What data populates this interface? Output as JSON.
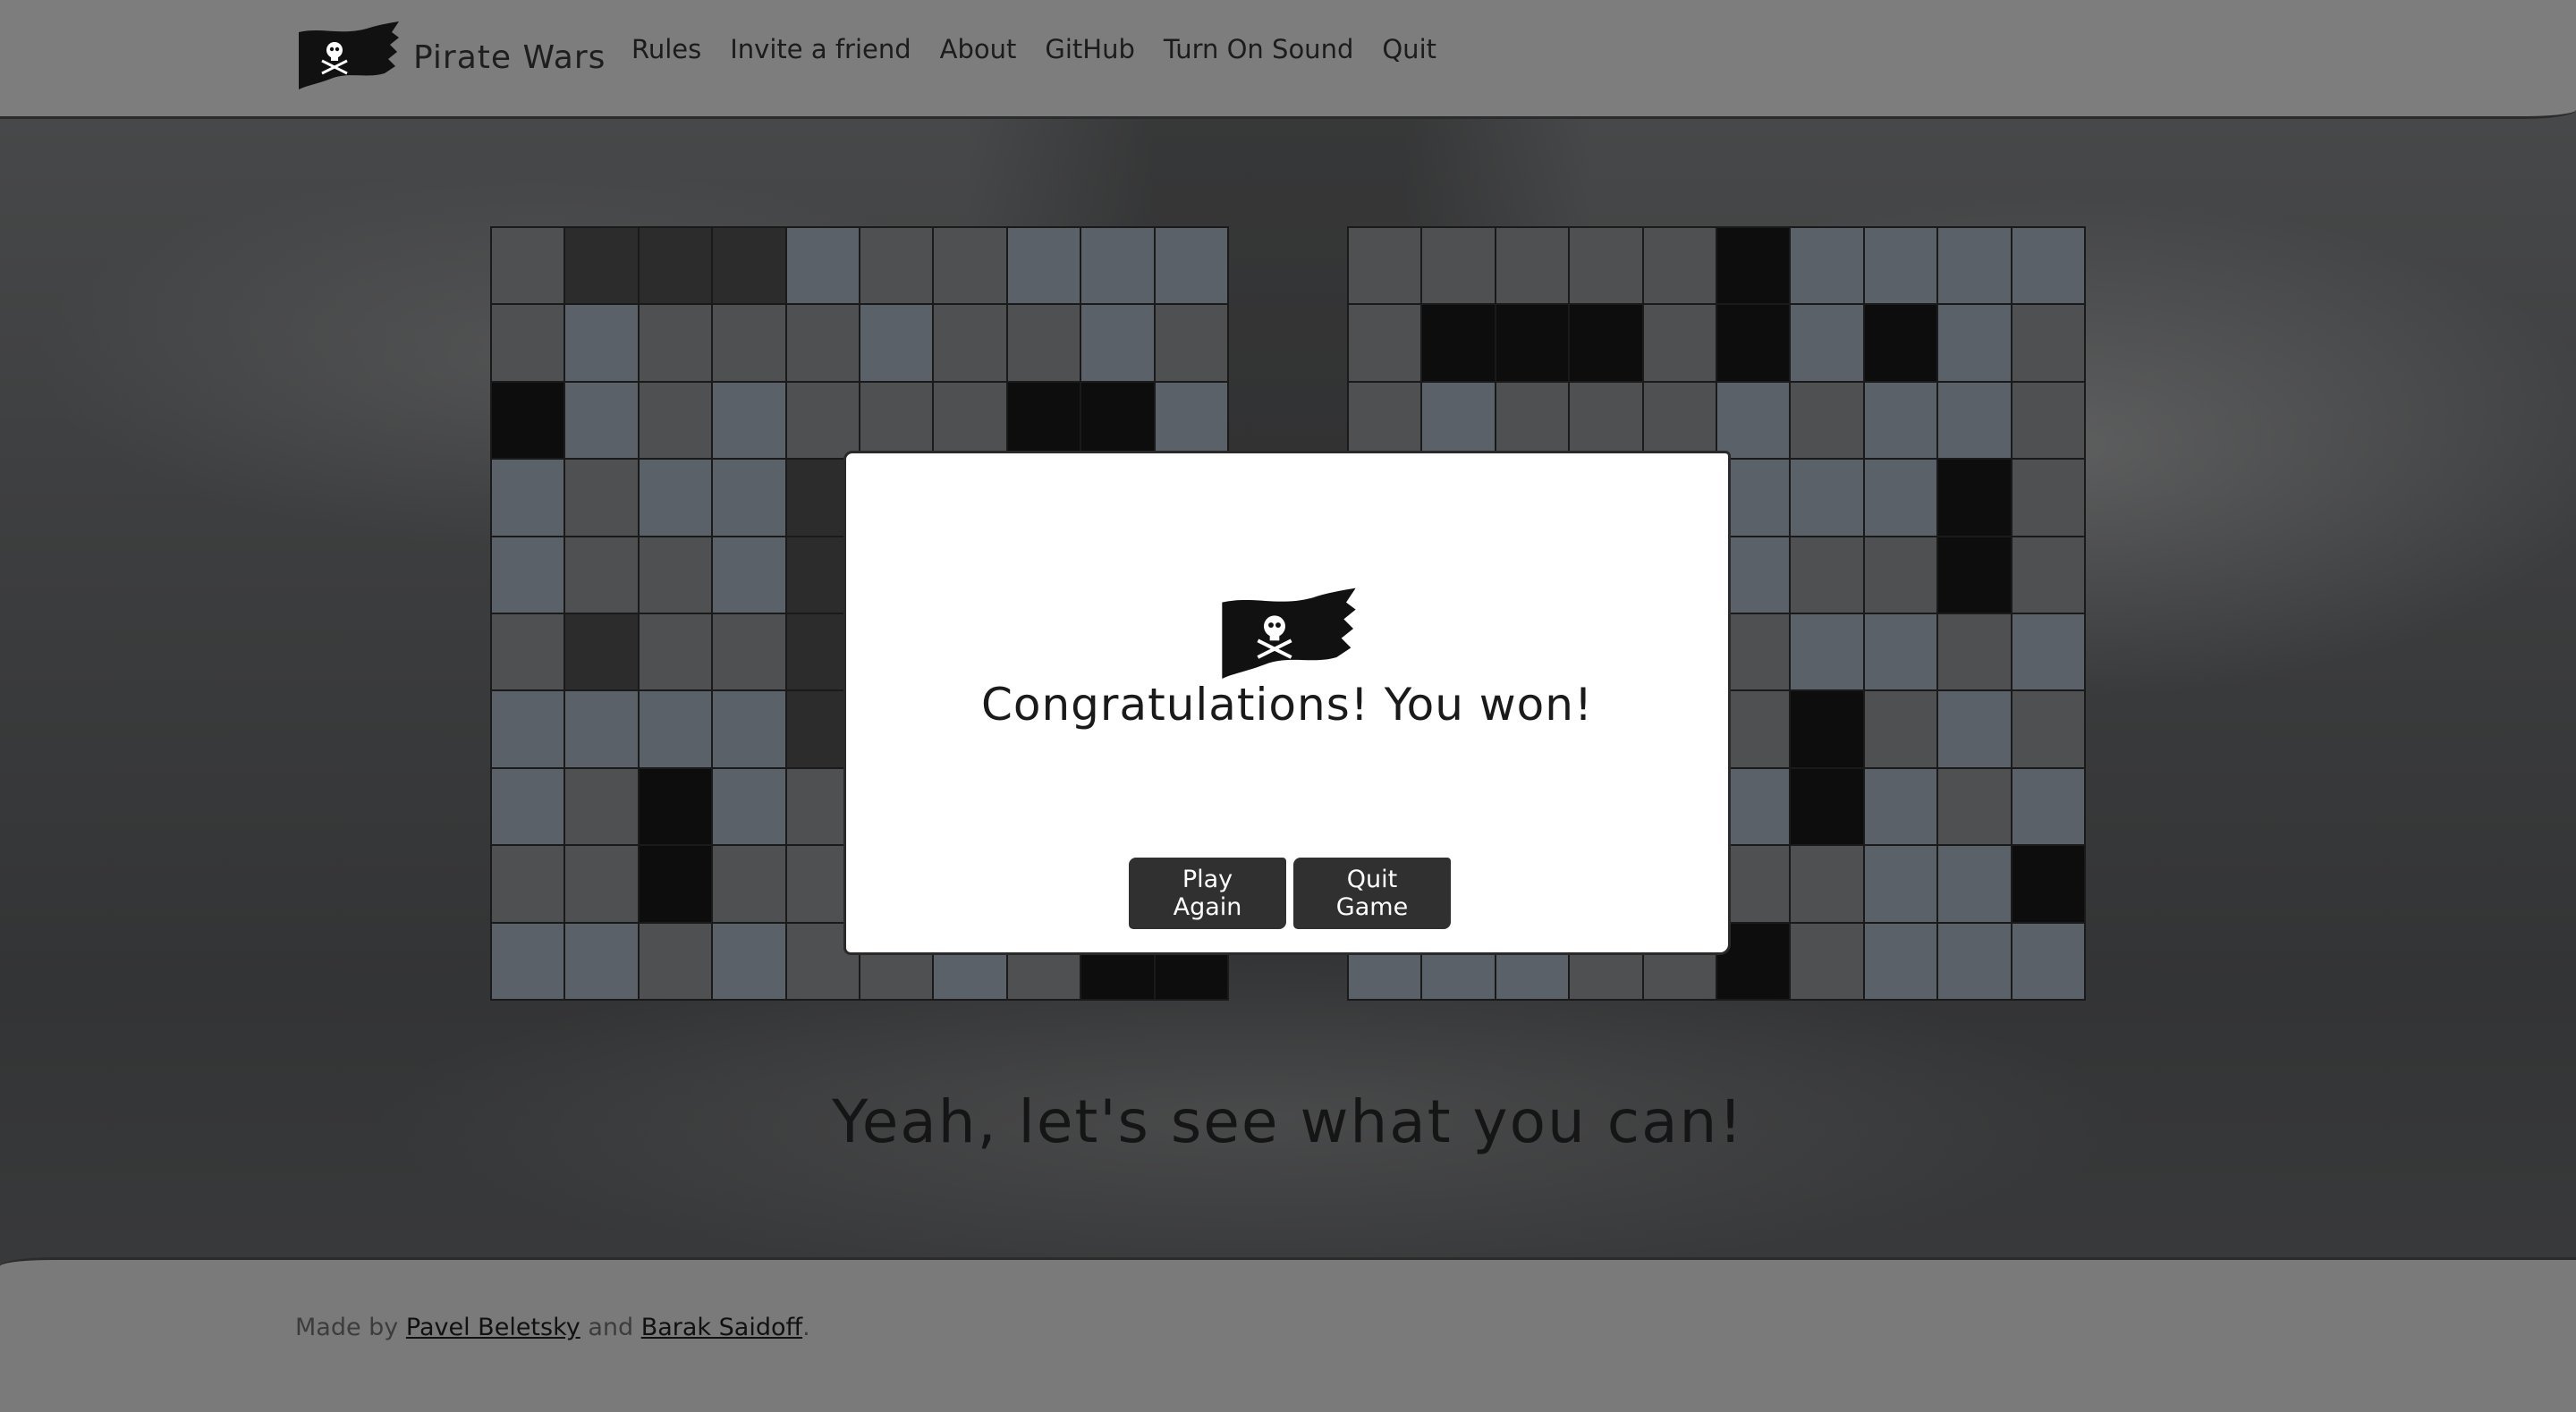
{
  "header": {
    "brand": "Pirate Wars",
    "logo_icon": "pirate-flag-icon",
    "nav": [
      "Rules",
      "Invite a friend",
      "About",
      "GitHub",
      "Turn On Sound",
      "Quit"
    ]
  },
  "boards": {
    "left": [
      [
        0,
        2,
        2,
        2,
        1,
        0,
        0,
        1,
        1,
        1
      ],
      [
        0,
        1,
        0,
        0,
        0,
        1,
        0,
        0,
        1,
        0
      ],
      [
        3,
        1,
        0,
        1,
        0,
        0,
        0,
        3,
        3,
        1
      ],
      [
        1,
        0,
        1,
        1,
        2,
        0,
        0,
        0,
        0,
        0
      ],
      [
        1,
        0,
        0,
        1,
        2,
        0,
        0,
        0,
        0,
        0
      ],
      [
        0,
        2,
        0,
        0,
        2,
        0,
        0,
        0,
        0,
        0
      ],
      [
        1,
        1,
        1,
        1,
        2,
        0,
        0,
        0,
        0,
        0
      ],
      [
        1,
        0,
        3,
        1,
        0,
        0,
        0,
        0,
        0,
        0
      ],
      [
        0,
        0,
        3,
        0,
        0,
        0,
        0,
        0,
        0,
        0
      ],
      [
        1,
        1,
        0,
        1,
        0,
        0,
        1,
        0,
        3,
        3
      ]
    ],
    "right": [
      [
        0,
        0,
        0,
        0,
        0,
        3,
        1,
        1,
        1,
        1
      ],
      [
        0,
        3,
        3,
        3,
        0,
        3,
        1,
        3,
        1,
        0
      ],
      [
        0,
        1,
        0,
        0,
        0,
        1,
        0,
        1,
        1,
        0
      ],
      [
        0,
        0,
        0,
        0,
        0,
        1,
        1,
        1,
        3,
        0
      ],
      [
        0,
        0,
        0,
        0,
        0,
        1,
        0,
        0,
        3,
        0
      ],
      [
        0,
        0,
        0,
        0,
        0,
        0,
        1,
        1,
        0,
        1
      ],
      [
        0,
        0,
        0,
        0,
        0,
        0,
        3,
        0,
        1,
        0
      ],
      [
        0,
        0,
        0,
        0,
        0,
        1,
        3,
        1,
        0,
        1
      ],
      [
        0,
        0,
        0,
        0,
        0,
        0,
        0,
        1,
        1,
        3
      ],
      [
        1,
        1,
        1,
        0,
        0,
        3,
        0,
        1,
        1,
        1
      ]
    ],
    "cell_colors": {
      "0": "#4f5051",
      "1": "#5a6169",
      "2": "#2c2c2c",
      "3": "#0d0d0d"
    }
  },
  "taunt": "Yeah, let's see what you can!",
  "modal": {
    "icon": "pirate-flag-icon",
    "title": "Congratulations! You won!",
    "play_again": "Play Again",
    "quit_game": "Quit Game"
  },
  "footer": {
    "prefix": "Made by",
    "author1": "Pavel Beletsky",
    "conj": "and",
    "author2": "Barak Saidoff",
    "suffix": "."
  }
}
